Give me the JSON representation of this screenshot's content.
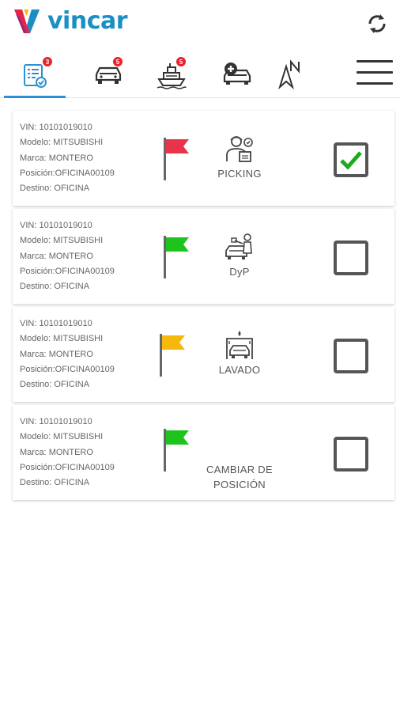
{
  "app": {
    "brand": "vincar",
    "accent_color": "#1a8fc4",
    "active_tab_color": "#2d8fd5",
    "badge_color": "#e8232f"
  },
  "tabs": [
    {
      "name": "tasks",
      "icon": "checklist-icon",
      "badge": "3",
      "active": true
    },
    {
      "name": "vehicles",
      "icon": "car-icon",
      "badge": "5",
      "active": false
    },
    {
      "name": "shipments",
      "icon": "ship-icon",
      "badge": "5",
      "active": false
    },
    {
      "name": "add-vehicle",
      "icon": "car-plus-icon",
      "badge": "",
      "active": false
    },
    {
      "name": "navigation",
      "icon": "north-arrow-icon",
      "badge": "",
      "active": false
    }
  ],
  "labels": {
    "vin": "VIN: ",
    "modelo": "Modelo: ",
    "marca": "Marca: ",
    "posicion": "Posición:",
    "destino": "Destino: "
  },
  "vehicles": [
    {
      "vin": "10101019010",
      "modelo": "MITSUBISHI",
      "marca": "MONTERO",
      "posicion": "OFICINA00109",
      "destino": "OFICINA",
      "flag_color": "#e8344a",
      "station_icon": "picking-worker-icon",
      "station_label": "PICKING",
      "checked": true
    },
    {
      "vin": "10101019010",
      "modelo": "MITSUBISHI",
      "marca": "MONTERO",
      "posicion": "OFICINA00109",
      "destino": "OFICINA",
      "flag_color": "#1ec31e",
      "station_icon": "paint-repair-icon",
      "station_label": "DyP",
      "checked": false
    },
    {
      "vin": "10101019010",
      "modelo": "MITSUBISHI",
      "marca": "MONTERO",
      "posicion": "OFICINA00109",
      "destino": "OFICINA",
      "flag_color": "#f5b80c",
      "station_icon": "car-wash-icon",
      "station_label": "LAVADO",
      "checked": false
    },
    {
      "vin": "10101019010",
      "modelo": "MITSUBISHI",
      "marca": "MONTERO",
      "posicion": "OFICINA00109",
      "destino": "OFICINA",
      "flag_color": "#1ec31e",
      "station_icon": "",
      "station_label": "CAMBIAR DE POSICIÓN",
      "checked": false
    }
  ]
}
